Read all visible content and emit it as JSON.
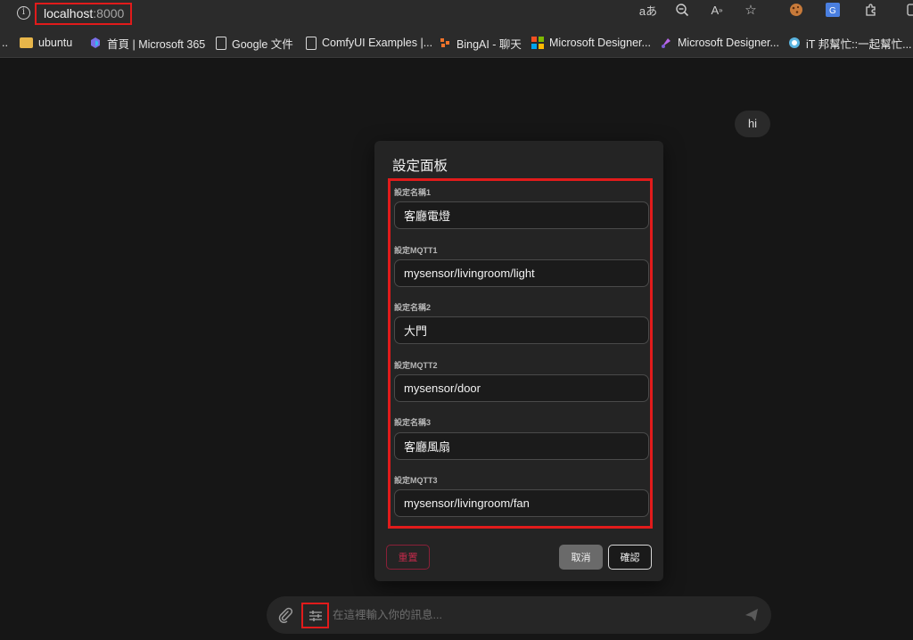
{
  "browser": {
    "url_host": "localhost",
    "url_port": ":8000",
    "bookmarks": [
      {
        "label": "ubuntu",
        "icon": "folder-icon"
      },
      {
        "label": "首頁 | Microsoft 365",
        "icon": "m365-icon"
      },
      {
        "label": "Google 文件",
        "icon": "document-icon"
      },
      {
        "label": "ComfyUI Examples |...",
        "icon": "document-icon"
      },
      {
        "label": "BingAI - 聊天",
        "icon": "bing-icon"
      },
      {
        "label": "Microsoft Designer...",
        "icon": "microsoft-icon"
      },
      {
        "label": "Microsoft Designer...",
        "icon": "designer-icon"
      },
      {
        "label": "iT 邦幫忙::一起幫忙...",
        "icon": "ithome-icon"
      }
    ]
  },
  "chat": {
    "user_message": "hi",
    "input_placeholder": "在這裡輸入你的訊息..."
  },
  "modal": {
    "title": "設定面板",
    "fields": [
      {
        "label": "設定名稱1",
        "value": "客廳電燈"
      },
      {
        "label": "設定MQTT1",
        "value": "mysensor/livingroom/light"
      },
      {
        "label": "設定名稱2",
        "value": "大門"
      },
      {
        "label": "設定MQTT2",
        "value": "mysensor/door"
      },
      {
        "label": "設定名稱3",
        "value": "客廳風扇"
      },
      {
        "label": "設定MQTT3",
        "value": "mysensor/livingroom/fan"
      }
    ],
    "reset_label": "重置",
    "cancel_label": "取消",
    "confirm_label": "確認"
  },
  "colors": {
    "highlight": "#e11b1b",
    "reset_text": "#c02a4a",
    "panel_bg": "#242424",
    "page_bg": "#161616"
  }
}
